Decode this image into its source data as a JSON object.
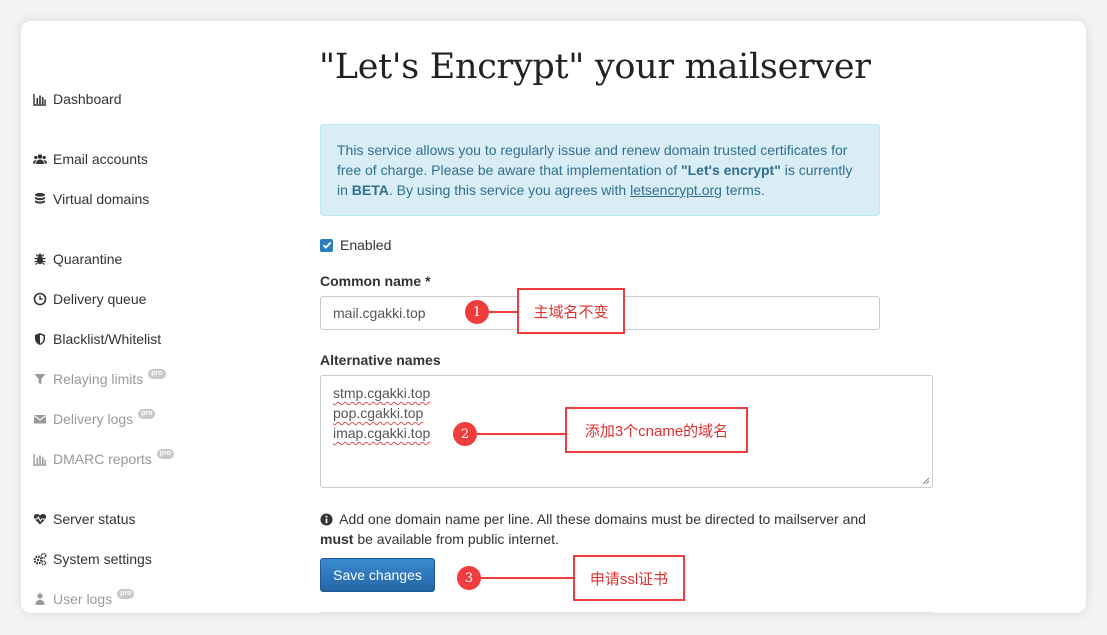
{
  "sidebar": {
    "items": [
      {
        "label": "Dashboard",
        "icon": "bar-chart-icon",
        "disabled": false,
        "pro": false
      },
      {
        "label": "Email accounts",
        "icon": "users-icon",
        "disabled": false,
        "pro": false
      },
      {
        "label": "Virtual domains",
        "icon": "database-icon",
        "disabled": false,
        "pro": false
      },
      {
        "label": "Quarantine",
        "icon": "bug-icon",
        "disabled": false,
        "pro": false
      },
      {
        "label": "Delivery queue",
        "icon": "clock-icon",
        "disabled": false,
        "pro": false
      },
      {
        "label": "Blacklist/Whitelist",
        "icon": "shield-icon",
        "disabled": false,
        "pro": false
      },
      {
        "label": "Relaying limits",
        "icon": "filter-icon",
        "disabled": true,
        "pro": true
      },
      {
        "label": "Delivery logs",
        "icon": "envelope-icon",
        "disabled": true,
        "pro": true
      },
      {
        "label": "DMARC reports",
        "icon": "bar-chart-icon",
        "disabled": true,
        "pro": true
      },
      {
        "label": "Server status",
        "icon": "heartbeat-icon",
        "disabled": false,
        "pro": false
      },
      {
        "label": "System settings",
        "icon": "gears-icon",
        "disabled": false,
        "pro": false
      },
      {
        "label": "User logs",
        "icon": "user-icon",
        "disabled": true,
        "pro": true
      }
    ],
    "pro_badge": "pro"
  },
  "main": {
    "title": "\"Let's Encrypt\" your mailserver",
    "alert": {
      "part1": "This service allows you to regularly issue and renew domain trusted certificates for free of charge. Please be aware that implementation of ",
      "bold1": "\"Let's encrypt\"",
      "part2": " is currently in ",
      "bold2": "BETA",
      "part3": ". By using this service you agrees with ",
      "link": "letsencrypt.org",
      "part4": " terms."
    },
    "enabled_label": "Enabled",
    "enabled_checked": true,
    "common_name_label": "Common name",
    "required_mark": " *",
    "common_name_value": "mail.cgakki.top",
    "alt_names_label": "Alternative names",
    "alt_names": [
      "stmp.cgakki.top",
      "pop.cgakki.top",
      "imap.cgakki.top"
    ],
    "help_text_1": " Add one domain name per line. All these domains must be directed to mailserver and ",
    "help_bold": "must",
    "help_text_2": " be available from public internet.",
    "save_label": "Save changes"
  },
  "annotations": [
    {
      "number": "1",
      "text": "主域名不变"
    },
    {
      "number": "2",
      "text": "添加3个cname的域名"
    },
    {
      "number": "3",
      "text": "申请ssl证书"
    }
  ],
  "colors": {
    "accent": "#2a7fbd",
    "alert_bg": "#d9edf7",
    "alert_text": "#31708f",
    "annotation_red": "#f03c3c"
  }
}
